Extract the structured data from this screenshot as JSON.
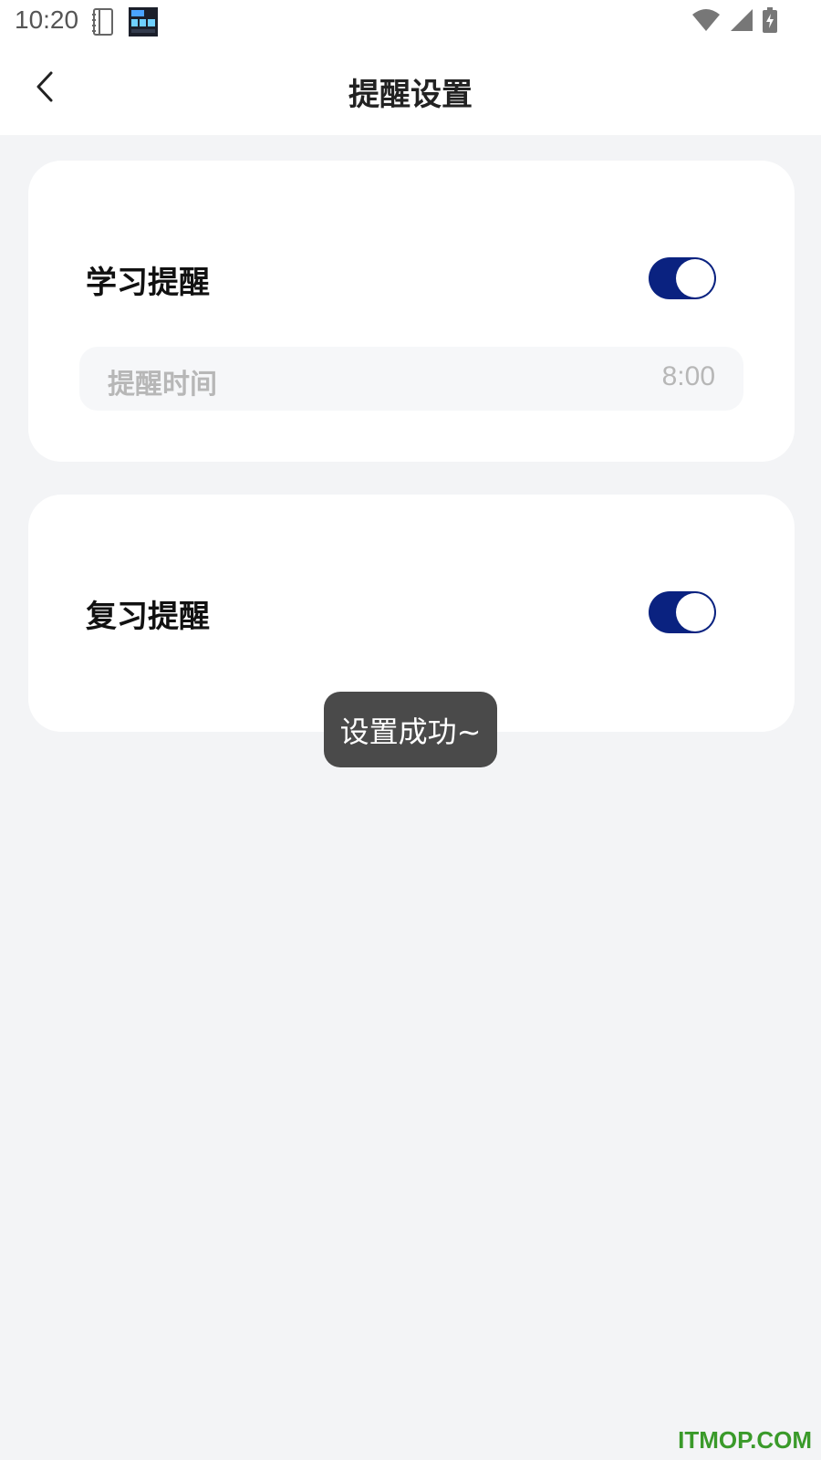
{
  "status_bar": {
    "time": "10:20",
    "icons": [
      "notebook-icon",
      "app-thumbnail-icon",
      "wifi-icon",
      "signal-icon",
      "battery-charging-icon"
    ]
  },
  "header": {
    "title": "提醒设置",
    "back_icon": "chevron-left-icon"
  },
  "study_reminder": {
    "label": "学习提醒",
    "enabled": true,
    "time_label": "提醒时间",
    "time_value": "8:00"
  },
  "review_reminder": {
    "label": "复习提醒",
    "enabled": true
  },
  "toast": {
    "message": "设置成功~"
  },
  "watermark": {
    "text": "ITMOP.COM"
  },
  "colors": {
    "accent": "#0a2280",
    "background": "#f3f4f6",
    "card": "#ffffff",
    "toast": "#4a4a4a",
    "watermark": "#3a9a2a"
  }
}
